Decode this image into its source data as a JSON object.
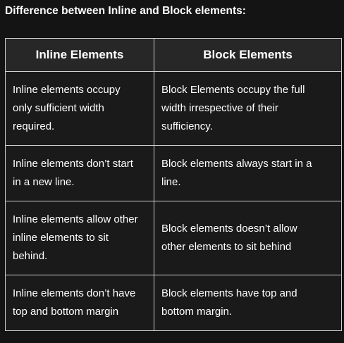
{
  "heading": "Difference between Inline and Block elements:",
  "table": {
    "headers": [
      "Inline Elements",
      "Block Elements"
    ],
    "rows": [
      [
        "Inline elements occupy\nonly sufficient width\nrequired.",
        " Block Elements occupy the full\nwidth irrespective of their\nsufficiency."
      ],
      [
        "Inline elements don’t start\nin a new line.",
        "Block elements always start in a\nline."
      ],
      [
        "Inline elements allow other\ninline elements to sit\nbehind.",
        "Block elements doesn’t allow\nother elements to sit behind"
      ],
      [
        "Inline elements don’t have\ntop and bottom margin",
        "Block elements have top and\nbottom margin."
      ]
    ]
  }
}
